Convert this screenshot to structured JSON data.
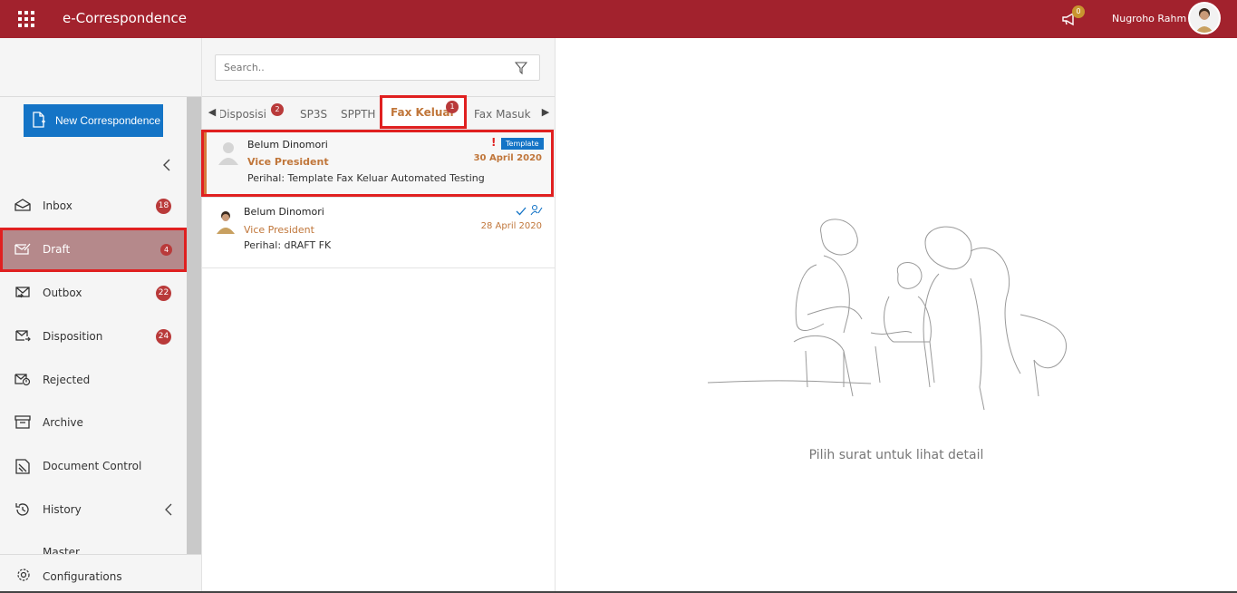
{
  "app": {
    "title": "e-Correspondence",
    "brand_color": "#a2222d"
  },
  "header": {
    "notification_count": "0",
    "user_name": "Nugroho Rahm",
    "apps_icon": "grid-icon",
    "notification_icon": "megaphone-icon"
  },
  "sidebar": {
    "new_button_label": "New Correspondence",
    "items": [
      {
        "label": "Inbox",
        "count": "18",
        "icon": "inbox-icon"
      },
      {
        "label": "Draft",
        "count": "4",
        "icon": "draft-icon"
      },
      {
        "label": "Outbox",
        "count": "22",
        "icon": "outbox-icon"
      },
      {
        "label": "Disposition",
        "count": "24",
        "icon": "disposition-icon"
      },
      {
        "label": "Rejected",
        "count": "",
        "icon": "rejected-icon"
      },
      {
        "label": "Archive",
        "count": "",
        "icon": "archive-icon"
      },
      {
        "label": "Document Control",
        "count": "",
        "icon": "document-control-icon"
      },
      {
        "label": "History",
        "count": "",
        "icon": "history-icon"
      },
      {
        "label": "Master",
        "count": "",
        "icon": "master-icon"
      }
    ],
    "config_label": "Configurations"
  },
  "search": {
    "placeholder": "Search.."
  },
  "tabs": [
    {
      "label": "Disposisi",
      "badge": "2"
    },
    {
      "label": "SP3S",
      "badge": ""
    },
    {
      "label": "SPPTH",
      "badge": ""
    },
    {
      "label": "Fax Keluar",
      "badge": "1"
    },
    {
      "label": "Fax Masuk",
      "badge": ""
    }
  ],
  "list": [
    {
      "name": "Belum Dinomori",
      "role": "Vice President",
      "subject": "Perihal: Template Fax Keluar Automated Testing",
      "date": "30 April 2020",
      "tag": "Template",
      "urgent": "!"
    },
    {
      "name": "Belum Dinomori",
      "role": "Vice President",
      "subject": "Perihal: dRAFT FK",
      "date": "28 April 2020"
    }
  ],
  "detail": {
    "empty_text": "Pilih surat untuk lihat detail"
  }
}
